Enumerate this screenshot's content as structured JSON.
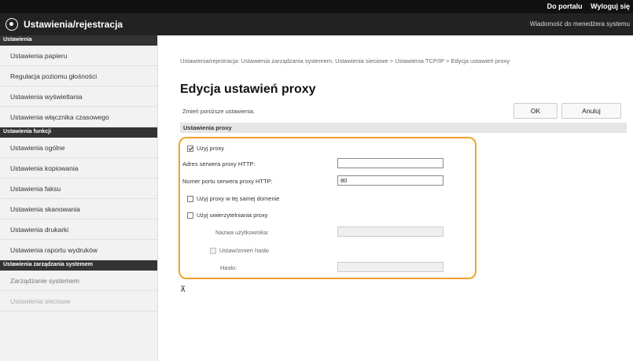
{
  "topbar": {
    "device": "",
    "portal_link": "Do portalu",
    "logout_link": "Wyloguj się"
  },
  "header": {
    "title": "Ustawienia/rejestracja",
    "message_link": "Wiadomość do menedżera systemu"
  },
  "sidebar": {
    "sections": [
      {
        "title": "Ustawienia",
        "items": [
          "Ustawienia papieru",
          "Regulacja poziomu głośności",
          "Ustawienia wyświetlania",
          "Ustawienia włącznika czasowego"
        ]
      },
      {
        "title": "Ustawienia funkcji",
        "items": [
          "Ustawienia ogólne",
          "Ustawienia kopiowania",
          "Ustawienia faksu",
          "Ustawienia skanowania",
          "Ustawienia drukarki",
          "Ustawienia raportu wydruków"
        ]
      },
      {
        "title": "Ustawienia zarządzania systemem",
        "items": [
          "Zarządzanie systemem",
          "Ustawienia sieciowe"
        ]
      }
    ]
  },
  "main": {
    "breadcrumb": "Ustawienia/rejestracja: Ustawienia zarządzania systemem: Ustawienia sieciowe > Ustawienia TCP/IP > Edycja ustawień proxy",
    "heading": "Edycja ustawień proxy",
    "instruction": "Zmień poniższe ustawienia.",
    "ok_label": "OK",
    "cancel_label": "Anuluj",
    "section_title": "Ustawienia proxy",
    "use_proxy_label": "Użyj proxy",
    "use_proxy_checked": true,
    "http_address_label": "Adres serwera proxy HTTP:",
    "http_address_value": "",
    "http_port_label": "Numer portu serwera proxy HTTP:",
    "http_port_value": "80",
    "same_domain_label": "Użyj proxy w tej samej domenie",
    "same_domain_checked": false,
    "proxy_auth_label": "Użyj uwierzytelniania proxy",
    "proxy_auth_checked": false,
    "username_label": "Nazwa użytkownika:",
    "username_value": "",
    "set_password_label": "Ustaw/zmień hasło",
    "set_password_checked": false,
    "password_label": "Hasło:",
    "password_value": "",
    "to_top_symbol": "⊼"
  },
  "colors": {
    "highlight": "#f3a12b",
    "topbar": "#111111",
    "header": "#222222"
  }
}
